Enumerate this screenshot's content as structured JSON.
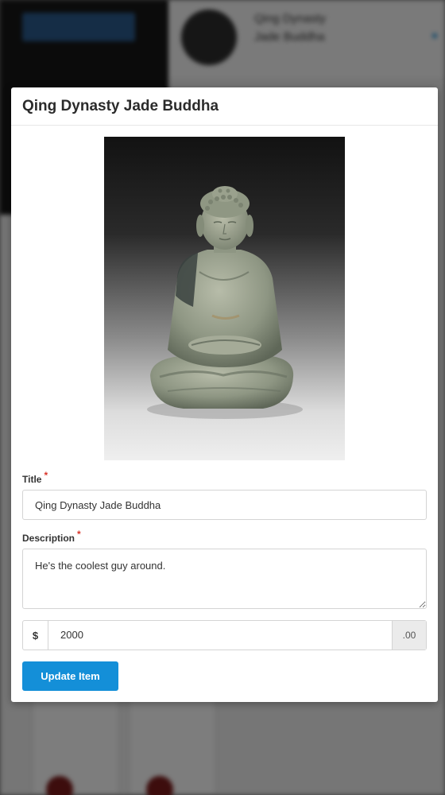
{
  "background": {
    "hero_button_label": "",
    "item_title": "Qing Dynasty Jade Buddha",
    "item_price": ""
  },
  "modal": {
    "title": "Qing Dynasty Jade Buddha",
    "image_alt": "Jade Buddha statue",
    "title_field": {
      "label": "Title",
      "required_mark": "*",
      "value": "Qing Dynasty Jade Buddha"
    },
    "description_field": {
      "label": "Description",
      "required_mark": "*",
      "value": "He's the coolest guy around."
    },
    "price_field": {
      "prefix": "$",
      "value": "2000",
      "suffix": ".00"
    },
    "submit_label": "Update Item"
  },
  "colors": {
    "primary": "#148fd8",
    "required": "#d9362b",
    "overlay": "rgba(0,0,0,0.5)"
  }
}
